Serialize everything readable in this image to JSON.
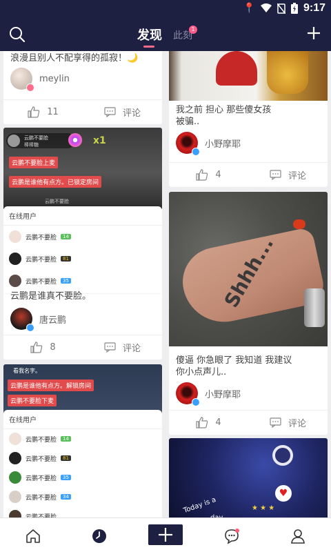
{
  "status_bar": {
    "time": "9:17"
  },
  "header": {
    "tab_active": "发现",
    "tab_other": "此刻",
    "tab_other_badge": "1"
  },
  "left_column": {
    "card1": {
      "text": "浪漫且别人不配享得的孤寂！🌙",
      "author": "meylin",
      "likes": "11",
      "comment_label": "评论"
    },
    "card2": {
      "overlay_user": "云鹏不要脸",
      "overlay_sub": "棒棒糖",
      "gift_count": "x1",
      "chat_lines": [
        "云鹏不要脸上麦",
        "云鹏是谁他有点方。已锁定房间",
        "云鹏不要脸"
      ],
      "online_title": "在线用户",
      "online_users": [
        {
          "name": "云鹏不要脸",
          "level": "14"
        },
        {
          "name": "云鹏不要脸",
          "level": "81"
        },
        {
          "name": "云鹏不要脸",
          "level": "35"
        }
      ],
      "text": "云鹏是谁真不要脸。",
      "author": "唐云鹏",
      "likes": "8",
      "comment_label": "评论"
    },
    "card3": {
      "overlay_line": "看我名字。",
      "chat_lines": [
        "云鹏是谁他有点方。解锁房间",
        "云鹏不要脸下麦"
      ],
      "online_title": "在线用户",
      "online_users": [
        {
          "name": "云鹏不要脸",
          "level": "14"
        },
        {
          "name": "云鹏不要脸",
          "level": "81"
        },
        {
          "name": "云鹏不要脸",
          "level": "35"
        },
        {
          "name": "云鹏不要脸",
          "level": "34"
        },
        {
          "name": "云鹏不要脸",
          "level": ""
        }
      ]
    }
  },
  "right_column": {
    "card1": {
      "text": "我之前 担心 那些傻女孩被骗..",
      "author": "小野摩耶",
      "likes": "4",
      "comment_label": "评论"
    },
    "card2": {
      "image_text": "Shhh...",
      "text": "傻逼 你急眼了 我知道 我建议你小点声儿..",
      "author": "小野摩耶",
      "likes": "4",
      "comment_label": "评论"
    },
    "card3": {
      "image_text_1": "Today is a",
      "image_text_2": "day"
    }
  },
  "colors": {
    "header_bg": "#1d2040",
    "accent": "#ff6b8a",
    "badge_blue": "#3aa0ff"
  },
  "icons": [
    "search-icon",
    "add-icon",
    "thumb-up-icon",
    "comment-icon",
    "home-icon",
    "clock-icon",
    "plus-icon",
    "chat-icon",
    "user-icon"
  ]
}
